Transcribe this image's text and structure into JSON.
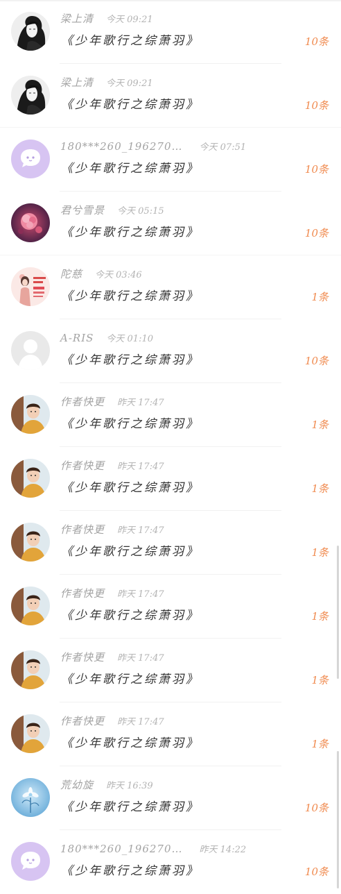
{
  "colors": {
    "count_accent": "#f08b50",
    "username": "#a3a3a3",
    "title": "#333333"
  },
  "messages": [
    {
      "username": "梁上清",
      "time": "今天 09:21",
      "title": "《少年歌行之综萧羽》",
      "count": "10条",
      "avatar": "ink-portrait-avatar"
    },
    {
      "username": "梁上清",
      "time": "今天 09:21",
      "title": "《少年歌行之综萧羽》",
      "count": "10条",
      "avatar": "ink-portrait-avatar"
    },
    {
      "username": "180***260_196270…",
      "time": "今天 07:51",
      "title": "《少年歌行之综萧羽》",
      "count": "10条",
      "avatar": "chat-bubble-avatar"
    },
    {
      "username": "君兮雪景",
      "time": "今天 05:15",
      "title": "《少年歌行之综萧羽》",
      "count": "10条",
      "avatar": "pink-flower-avatar"
    },
    {
      "username": "陀慈",
      "time": "今天 03:46",
      "title": "《少年歌行之综萧羽》",
      "count": "1条",
      "avatar": "girl-poster-avatar"
    },
    {
      "username": "A-RIS",
      "time": "今天 01:10",
      "title": "《少年歌行之综萧羽》",
      "count": "10条",
      "avatar": "default-user-avatar"
    },
    {
      "username": "作者快更",
      "time": "昨天 17:47",
      "title": "《少年歌行之综萧羽》",
      "count": "1条",
      "avatar": "boy-photo-avatar"
    },
    {
      "username": "作者快更",
      "time": "昨天 17:47",
      "title": "《少年歌行之综萧羽》",
      "count": "1条",
      "avatar": "boy-photo-avatar"
    },
    {
      "username": "作者快更",
      "time": "昨天 17:47",
      "title": "《少年歌行之综萧羽》",
      "count": "1条",
      "avatar": "boy-photo-avatar"
    },
    {
      "username": "作者快更",
      "time": "昨天 17:47",
      "title": "《少年歌行之综萧羽》",
      "count": "1条",
      "avatar": "boy-photo-avatar"
    },
    {
      "username": "作者快更",
      "time": "昨天 17:47",
      "title": "《少年歌行之综萧羽》",
      "count": "1条",
      "avatar": "boy-photo-avatar"
    },
    {
      "username": "作者快更",
      "time": "昨天 17:47",
      "title": "《少年歌行之综萧羽》",
      "count": "1条",
      "avatar": "boy-photo-avatar"
    },
    {
      "username": "荒幼旋",
      "time": "昨天 16:39",
      "title": "《少年歌行之综萧羽》",
      "count": "10条",
      "avatar": "blue-flower-avatar"
    },
    {
      "username": "180***260_196270…",
      "time": "昨天 14:22",
      "title": "《少年歌行之综萧羽》",
      "count": "10条",
      "avatar": "chat-bubble-avatar"
    }
  ]
}
